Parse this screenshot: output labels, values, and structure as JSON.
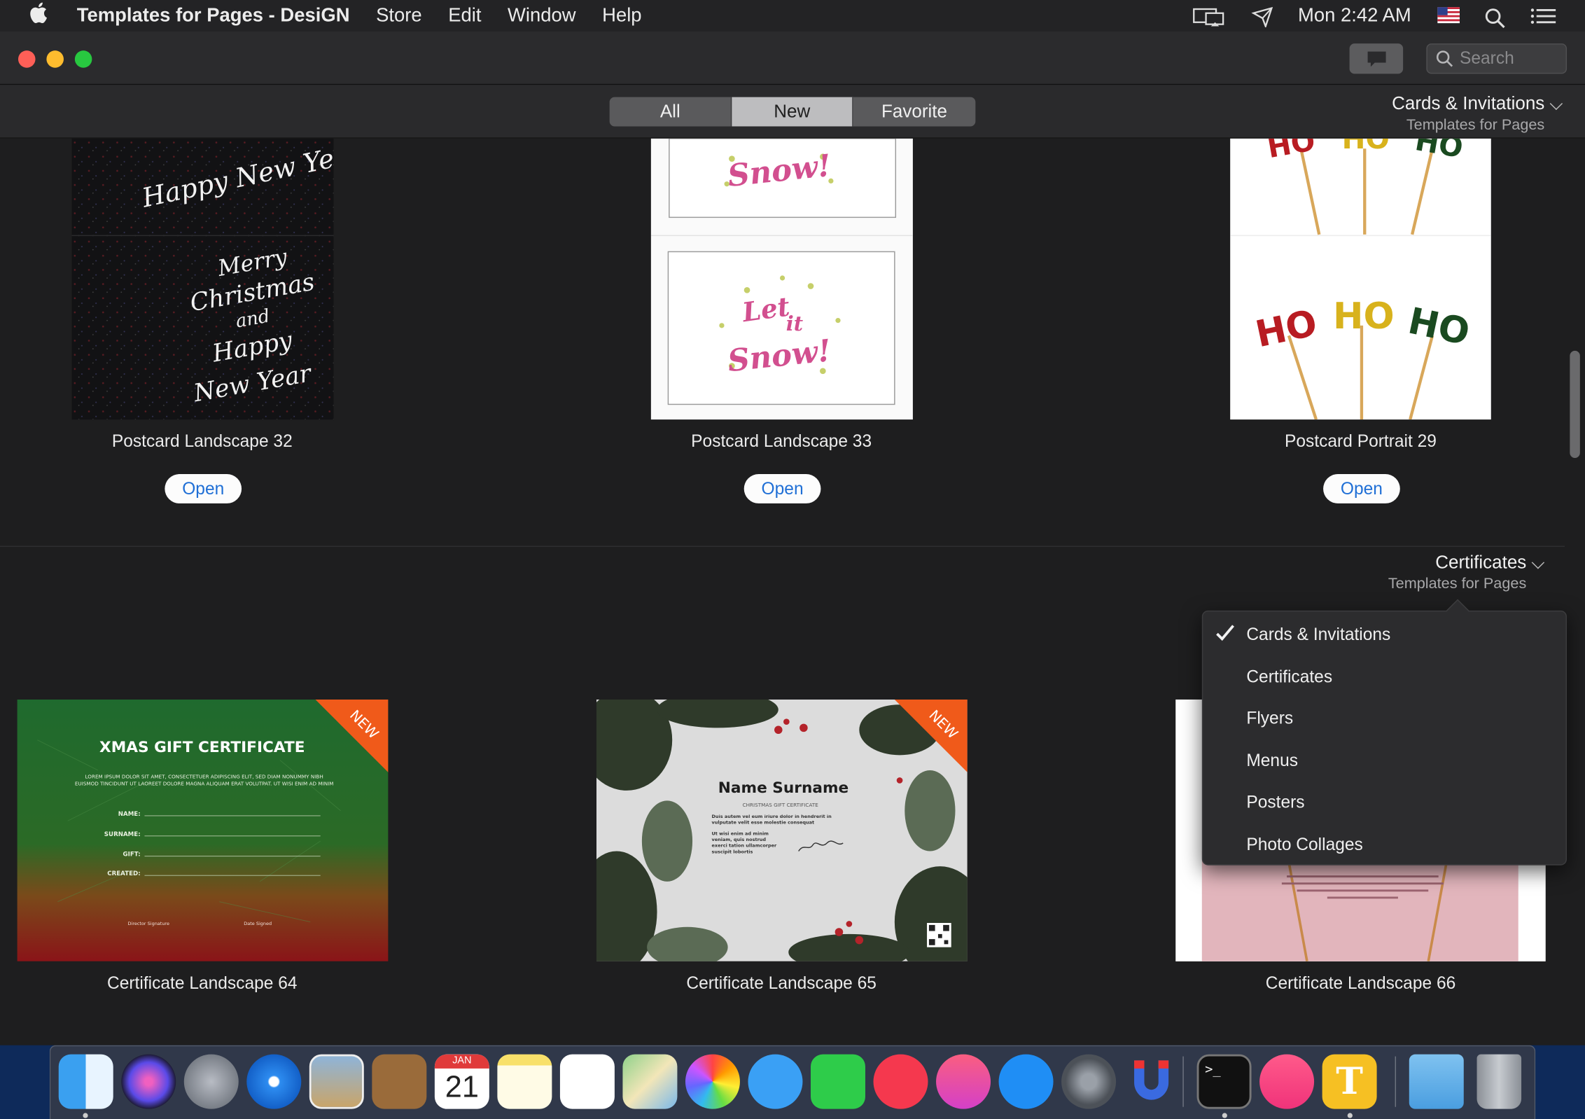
{
  "menubar": {
    "app_name": "Templates for Pages - DesiGN",
    "items": [
      "Store",
      "Edit",
      "Window",
      "Help"
    ],
    "clock": "Mon 2:42 AM"
  },
  "search": {
    "placeholder": "Search"
  },
  "tabs": [
    {
      "label": "All",
      "selected": false
    },
    {
      "label": "New",
      "selected": true
    },
    {
      "label": "Favorite",
      "selected": false
    }
  ],
  "section1": {
    "category": "Cards & Invitations",
    "subtitle": "Templates for Pages",
    "cards": [
      {
        "title": "Postcard Landscape 32",
        "button": "Open",
        "art_top": "Happy New Year",
        "art_bottom": [
          "Merry",
          "Christmas",
          "and",
          "Happy",
          "New Year"
        ]
      },
      {
        "title": "Postcard Landscape 33",
        "button": "Open",
        "art_top": "Snow!",
        "art_bottom": [
          "Let",
          "it",
          "Snow!"
        ]
      },
      {
        "title": "Postcard Portrait 29",
        "button": "Open",
        "art_word": "HO"
      }
    ]
  },
  "section2": {
    "category": "Certificates",
    "subtitle": "Templates for Pages",
    "cards": [
      {
        "title": "Certificate Landscape 64",
        "ribbon": "NEW",
        "heading": "XMAS GIFT CERTIFICATE",
        "lorem": "LOREM IPSUM DOLOR SIT AMET, CONSECTETUER ADIPISCING ELIT, SED DIAM NONUMMY NIBH EUISMOD TINCIDUNT UT LAOREET DOLORE MAGNA ALIQUAM ERAT VOLUTPAT. UT WISI ENIM AD MINIM",
        "fields": [
          "NAME:",
          "SURNAME:",
          "GIFT:",
          "CREATED:"
        ],
        "sig_left": "Director Signature",
        "sig_right": "Date Signed"
      },
      {
        "title": "Certificate Landscape 65",
        "ribbon": "NEW",
        "heading": "Name Surname",
        "sub": "CHRISTMAS GIFT CERTIFICATE",
        "body1": "Duis autem vel eum iriure dolor in hendrerit in vulputate velit esse molestie consequat",
        "body2": "Ut wisi enim ad minim veniam, quis nostrud exerci tation ullamcorper suscipit lobortis"
      },
      {
        "title": "Certificate Landscape 66"
      }
    ]
  },
  "dropdown": {
    "items": [
      "Cards & Invitations",
      "Certificates",
      "Flyers",
      "Menus",
      "Posters",
      "Photo Collages"
    ],
    "checked": "Cards & Invitations"
  },
  "dock": {
    "calendar_month": "JAN",
    "calendar_day": "21",
    "terminal_prompt": ">_",
    "text_app_letter": "T"
  },
  "colors": {
    "accent_blue": "#1f6fd6",
    "traffic_red": "#fe5f57",
    "traffic_yellow": "#febc2e",
    "traffic_green": "#28c840",
    "ribbon_orange": "#f05a1a"
  }
}
